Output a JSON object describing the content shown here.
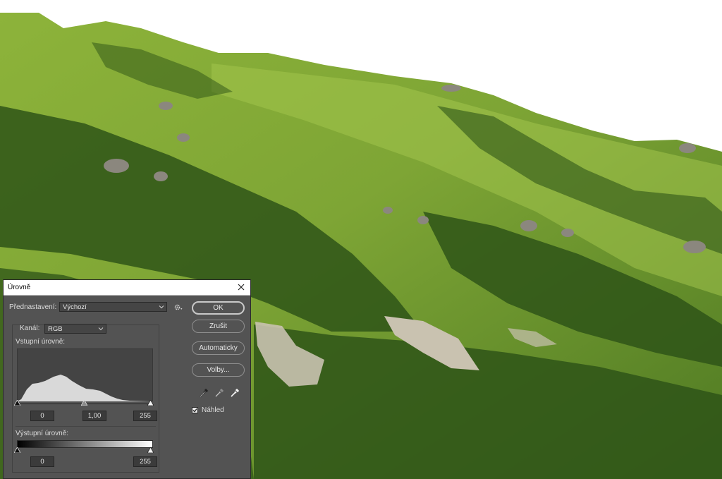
{
  "dialog": {
    "title": "Úrovně",
    "preset_label": "Přednastavení:",
    "preset_value": "Výchozí",
    "channel_label": "Kanál:",
    "channel_value": "RGB",
    "input_levels_label": "Vstupní úrovně:",
    "input_black": "0",
    "input_gamma": "1,00",
    "input_white": "255",
    "output_levels_label": "Výstupní úrovně:",
    "output_black": "0",
    "output_white": "255",
    "buttons": {
      "ok": "OK",
      "cancel": "Zrušit",
      "auto": "Automaticky",
      "options": "Volby..."
    },
    "preview_label": "Náhled",
    "preview_checked": true
  },
  "icons": {
    "close": "close-icon",
    "preset_menu": "gear-icon",
    "dropdown": "chevron-down-icon",
    "eyedropper_black": "eyedropper-black-icon",
    "eyedropper_gray": "eyedropper-gray-icon",
    "eyedropper_white": "eyedropper-white-icon"
  },
  "colors": {
    "dialog_bg": "#535353",
    "histogram_fill": "#d9d9d9",
    "sky": "#ffffff",
    "grass": "#6f9a2c"
  }
}
